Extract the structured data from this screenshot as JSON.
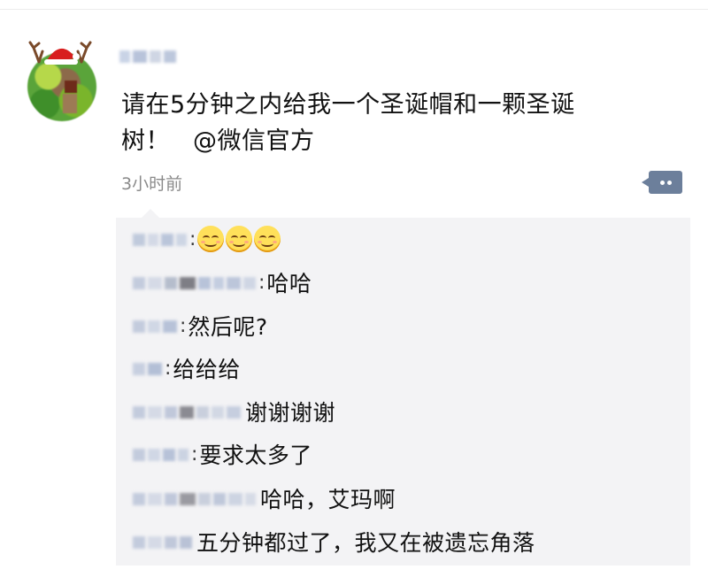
{
  "post": {
    "text_line1": "请在5分钟之内给我一个圣诞帽和一颗圣诞",
    "text_line2": "树！",
    "mention": "@微信官方",
    "timestamp": "3小时前",
    "avatar_icon": "reindeer-santa-hat-avatar",
    "comment_icon": "comment-bubble-icon"
  },
  "comments": [
    {
      "colon": ":",
      "text": "",
      "emoji": [
        "grinning-face",
        "grinning-face",
        "grinning-face"
      ]
    },
    {
      "colon": ":",
      "text": "哈哈"
    },
    {
      "colon": ":",
      "text": "然后呢?"
    },
    {
      "colon": ":",
      "text": "给给给"
    },
    {
      "colon": "",
      "text": "谢谢谢谢"
    },
    {
      "colon": ":",
      "text": "要求太多了"
    },
    {
      "colon": "",
      "text": "哈哈，艾玛啊"
    },
    {
      "colon": "",
      "text": "五分钟都过了，我又在被遗忘角落"
    }
  ],
  "colors": {
    "background": "#ffffff",
    "comments_background": "#f3f3f5",
    "timestamp": "#8a8a8a",
    "comment_button": "#6c7f9b"
  }
}
